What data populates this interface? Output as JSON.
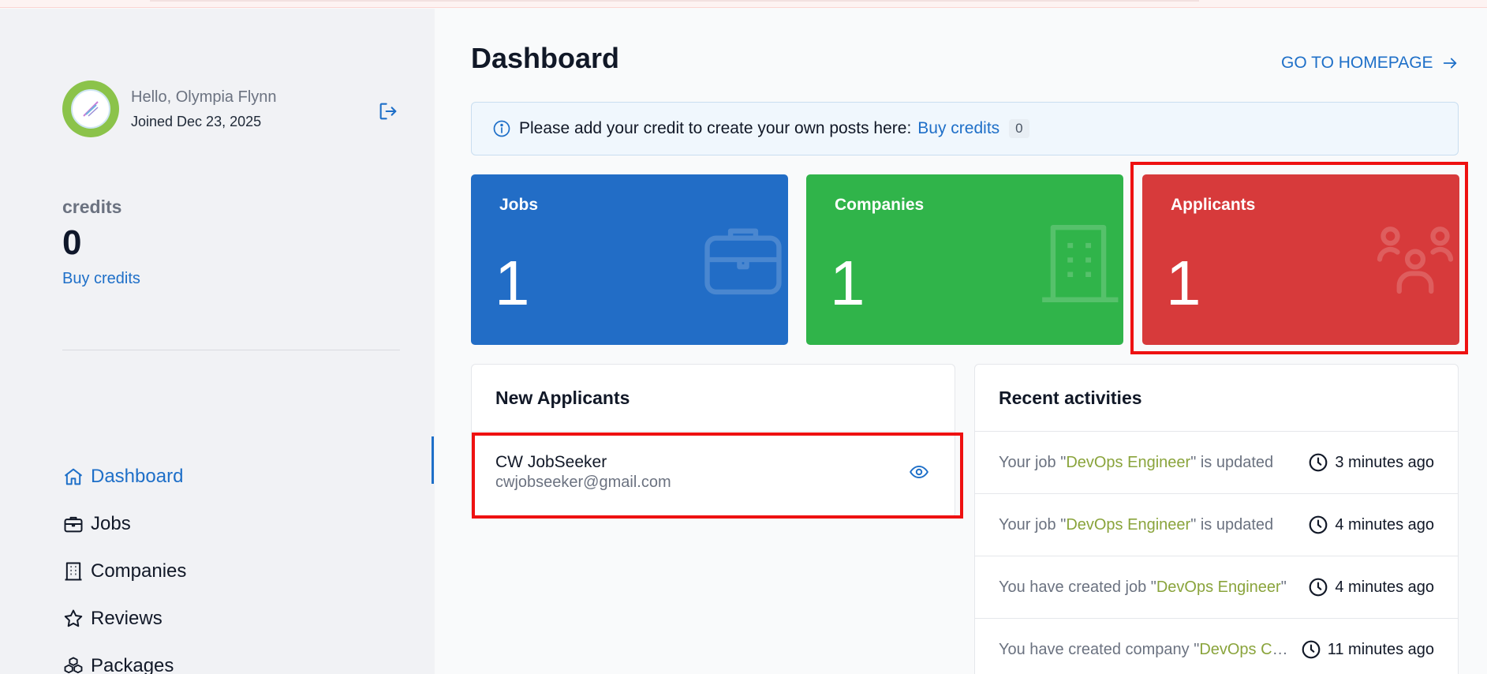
{
  "user": {
    "greeting": "Hello, Olympia Flynn",
    "joined": "Joined Dec 23, 2025"
  },
  "credits": {
    "label": "credits",
    "value": "0",
    "buy_label": "Buy credits"
  },
  "nav": {
    "items": [
      {
        "label": "Dashboard",
        "icon": "home-icon",
        "active": true
      },
      {
        "label": "Jobs",
        "icon": "briefcase-icon",
        "active": false
      },
      {
        "label": "Companies",
        "icon": "building-icon",
        "active": false
      },
      {
        "label": "Reviews",
        "icon": "star-icon",
        "active": false
      },
      {
        "label": "Packages",
        "icon": "cubes-icon",
        "active": false
      }
    ]
  },
  "header": {
    "title": "Dashboard",
    "go_home_label": "GO TO HOMEPAGE"
  },
  "info": {
    "message": "Please add your credit to create your own posts here:",
    "link": "Buy credits",
    "badge": "0"
  },
  "stats": [
    {
      "label": "Jobs",
      "value": "1",
      "color": "#226dc6",
      "icon": "briefcase-icon"
    },
    {
      "label": "Companies",
      "value": "1",
      "color": "#30b44a",
      "icon": "building-icon"
    },
    {
      "label": "Applicants",
      "value": "1",
      "color": "#d73a3b",
      "icon": "users-icon"
    }
  ],
  "new_applicants": {
    "title": "New Applicants",
    "items": [
      {
        "name": "CW JobSeeker",
        "email": "cwjobseeker@gmail.com"
      }
    ]
  },
  "recent_activities": {
    "title": "Recent activities",
    "items": [
      {
        "prefix": "Your job \"",
        "highlight": "DevOps Engineer",
        "suffix": "\" is updated",
        "time": "3 minutes ago"
      },
      {
        "prefix": "Your job \"",
        "highlight": "DevOps Engineer",
        "suffix": "\" is updated",
        "time": "4 minutes ago"
      },
      {
        "prefix": "You have created job \"",
        "highlight": "DevOps Engineer",
        "suffix": "\"",
        "time": "4 minutes ago"
      },
      {
        "prefix": "You have created company \"",
        "highlight": "DevOps Company",
        "suffix": "\"",
        "time": "11 minutes ago"
      }
    ]
  },
  "colors": {
    "accent": "#1e6fc8",
    "activity_highlight": "#8aa43c",
    "highlight_box": "#ee1111"
  }
}
